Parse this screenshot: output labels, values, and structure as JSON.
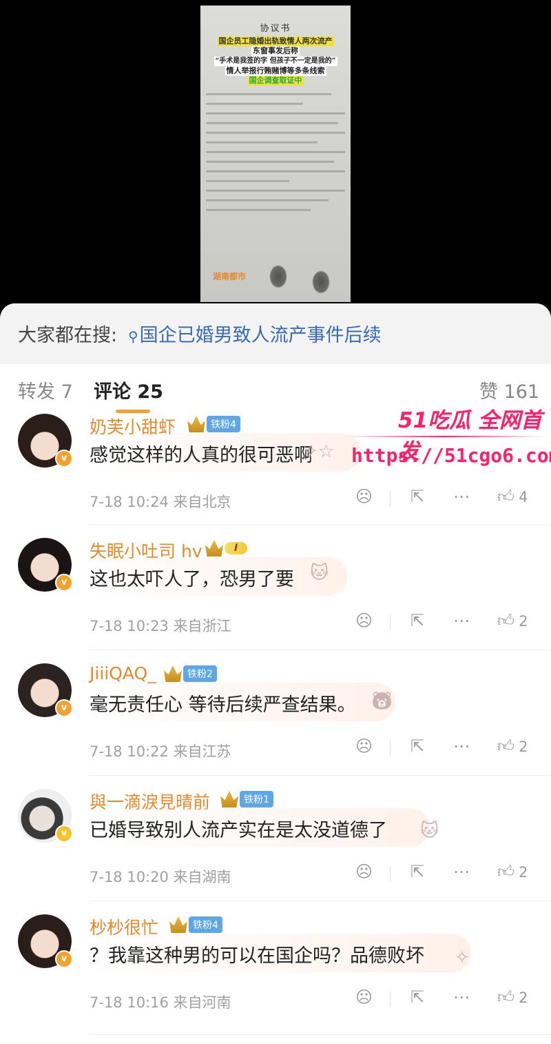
{
  "document_image": {
    "title": "协议书",
    "headlines": [
      "国企员工隐婚出轨致情人两次流产",
      "东窗事发后称",
      "“手术是我签的字 但孩子不一定是我的”",
      "情人举报行贿赌博等多条线索",
      "国企调查取证中"
    ],
    "footer_source": "湖南都市"
  },
  "search": {
    "prefix": "大家都在搜:",
    "query": "国企已婚男致人流产事件后续"
  },
  "tabs": {
    "repost": "转发 7",
    "comments": "评论 25",
    "likes": "赞 161"
  },
  "watermark": {
    "line1": "51吃瓜 全网首发",
    "line2": "https://51cgo6.com"
  },
  "comments": [
    {
      "name": "奶芙小甜虾",
      "badge": "铁粉4",
      "text": "感觉这样的人真的很可恶啊",
      "time": "7-18 10:24",
      "location": "来自北京",
      "likes": "4",
      "hair": "#2a1d1a"
    },
    {
      "name": "失眠小吐司 hv",
      "badge": "I",
      "text": "这也太吓人了，恐男了要",
      "time": "7-18 10:23",
      "location": "来自浙江",
      "likes": "2",
      "hair": "#1a1414"
    },
    {
      "name": "JiiiQAQ_",
      "badge": "铁粉2",
      "text": "毫无责任心 等待后续严查结果。",
      "time": "7-18 10:22",
      "location": "来自江苏",
      "likes": "2",
      "hair": "#2b2222"
    },
    {
      "name": "與一滴淚見晴前",
      "badge": "铁粉1",
      "text": "已婚导致别人流产实在是太没道德了",
      "time": "7-18 10:20",
      "location": "来自湖南",
      "likes": "2",
      "hair": "#3a3a3a"
    },
    {
      "name": "杪杪很忙",
      "badge": "铁粉4",
      "text": "？我靠这种男的可以在国企吗？品德败坏",
      "time": "7-18 10:16",
      "location": "来自河南",
      "likes": "2",
      "hair": "#2a1e1a"
    }
  ]
}
